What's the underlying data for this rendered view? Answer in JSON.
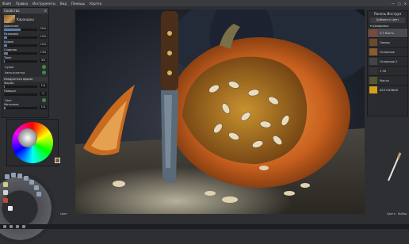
{
  "menu": {
    "items": [
      "Файл",
      "Правка",
      "Инструменты",
      "Вид",
      "Помощь",
      "Картка"
    ],
    "window_buttons": [
      "—",
      "▢",
      "✕"
    ]
  },
  "left_panel": {
    "title": "Свойства",
    "brush_name": "Карандаш",
    "params": [
      {
        "label": "Давление",
        "value": "50%",
        "level": 0.5
      },
      {
        "label": "Размывка",
        "value": "10%",
        "level": 0.1
      },
      {
        "label": "Кроме",
        "value": "10%",
        "level": 0.1
      },
      {
        "label": "Слияние",
        "value": "13%",
        "level": 0.13
      },
      {
        "label": "Темп",
        "value": "3%",
        "level": 0.03
      }
    ],
    "checks": [
      {
        "label": "Сухое",
        "checked": true
      },
      {
        "label": "Авто-очистка",
        "checked": true
      }
    ],
    "section_label": "Квадратная форма",
    "params2": [
      {
        "label": "Форма",
        "value": "1%",
        "level": 0.01
      },
      {
        "label": "Поворот",
        "value": "0",
        "level": 0.0
      }
    ],
    "checks2": [
      {
        "label": "Свет",
        "checked": true
      }
    ],
    "opacity": {
      "label": "Металлик",
      "value": "1%"
    }
  },
  "right_panel": {
    "title": "Панель Инструм",
    "add_button": "Добавить Цвет",
    "group": "▾ Шлифовка",
    "layers": [
      {
        "name": "3.7 Кисть",
        "color": "#7a4a3a",
        "active": true
      },
      {
        "name": "Лампы",
        "color": "#6b4a2a",
        "active": false
      },
      {
        "name": "Основные",
        "color": "#8a5a30",
        "active": false
      },
      {
        "name": "Основные 2",
        "color": "#444",
        "active": false
      },
      {
        "name": "1 96",
        "color": "#333",
        "active": false
      },
      {
        "name": "Масло",
        "color": "#553",
        "active": false
      },
      {
        "name": "БЕЗ НАЗВАН",
        "color": "#d4a017",
        "active": false
      }
    ]
  },
  "dock": {
    "color_label": "Цвет",
    "bottom_labels": [
      "Цвета",
      "Выбор"
    ]
  },
  "colors": {
    "accent": "#5c7fa8",
    "check": "#3f8a4c",
    "panel_bg": "#2a2b2f"
  }
}
